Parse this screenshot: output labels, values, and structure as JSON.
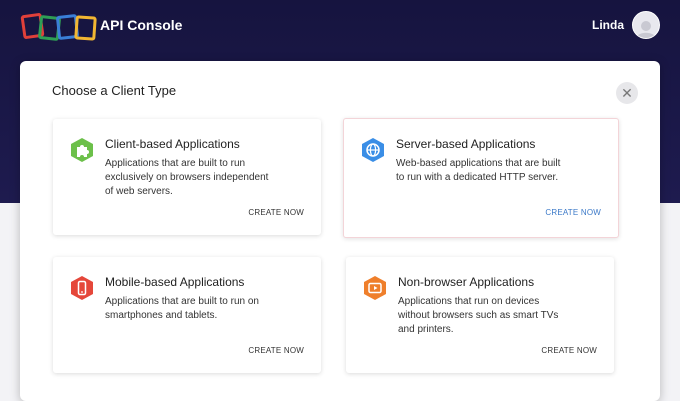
{
  "header": {
    "app_title": "API Console",
    "user_name": "Linda"
  },
  "modal": {
    "title": "Choose a Client Type",
    "close_symbol": "✕",
    "cards": [
      {
        "title": "Client-based Applications",
        "desc_lines": [
          "Applications that are built to run",
          "exclusively on browsers independent",
          "of web servers."
        ],
        "action": "CREATE NOW",
        "icon": "puzzle-icon",
        "color": "#6cc04a"
      },
      {
        "title": "Server-based Applications",
        "desc_lines": [
          "Web-based applications that are built",
          "to run with a dedicated HTTP server."
        ],
        "action": "CREATE NOW",
        "icon": "globe-icon",
        "color": "#3a8ee6",
        "action_color": "#3b79c8"
      },
      {
        "title": "Mobile-based Applications",
        "desc_lines": [
          "Applications that are built to run on",
          "smartphones and tablets."
        ],
        "action": "CREATE NOW",
        "icon": "mobile-icon",
        "color": "#e5473a"
      },
      {
        "title": "Non-browser Applications",
        "desc_lines": [
          "Applications that run on devices",
          "without browsers such as smart TVs",
          "and printers."
        ],
        "action": "CREATE NOW",
        "icon": "tv-icon",
        "color": "#ef7f2b"
      }
    ]
  },
  "colors": {
    "header_bg": "#1a1846",
    "logo": [
      "#e0403a",
      "#2f9e55",
      "#3a7fd8",
      "#f2b632"
    ]
  }
}
